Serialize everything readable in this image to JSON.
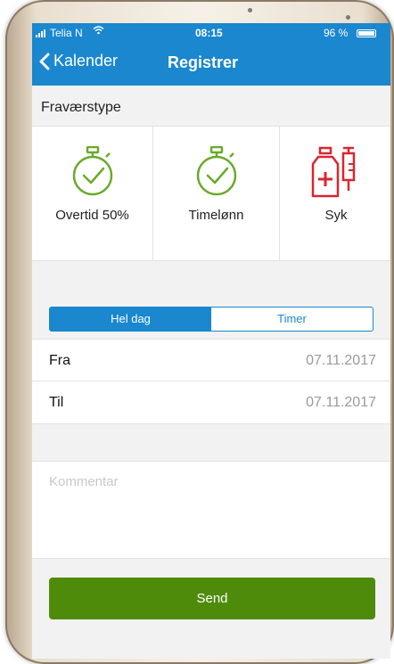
{
  "status_bar": {
    "carrier": "Telia N",
    "time": "08:15",
    "battery": "96 %"
  },
  "nav": {
    "back_label": "Kalender",
    "title": "Registrer"
  },
  "absence_section": {
    "label": "Fraværstype",
    "types": [
      {
        "label": "Overtid 50%",
        "icon": "stopwatch-check-icon"
      },
      {
        "label": "Timelønn",
        "icon": "stopwatch-check-icon"
      },
      {
        "label": "Syk",
        "icon": "medicine-syringe-icon"
      }
    ]
  },
  "duration_toggle": {
    "options": [
      "Hel dag",
      "Timer"
    ],
    "selected": "Hel dag"
  },
  "dates": {
    "from_label": "Fra",
    "from_value": "07.11.2017",
    "to_label": "Til",
    "to_value": "07.11.2017"
  },
  "comment": {
    "placeholder": "Kommentar"
  },
  "send_button": {
    "label": "Send"
  },
  "colors": {
    "header": "#1a87cf",
    "send": "#4e8b0a",
    "icon_green": "#6aaa2a",
    "icon_red": "#d9262f"
  }
}
